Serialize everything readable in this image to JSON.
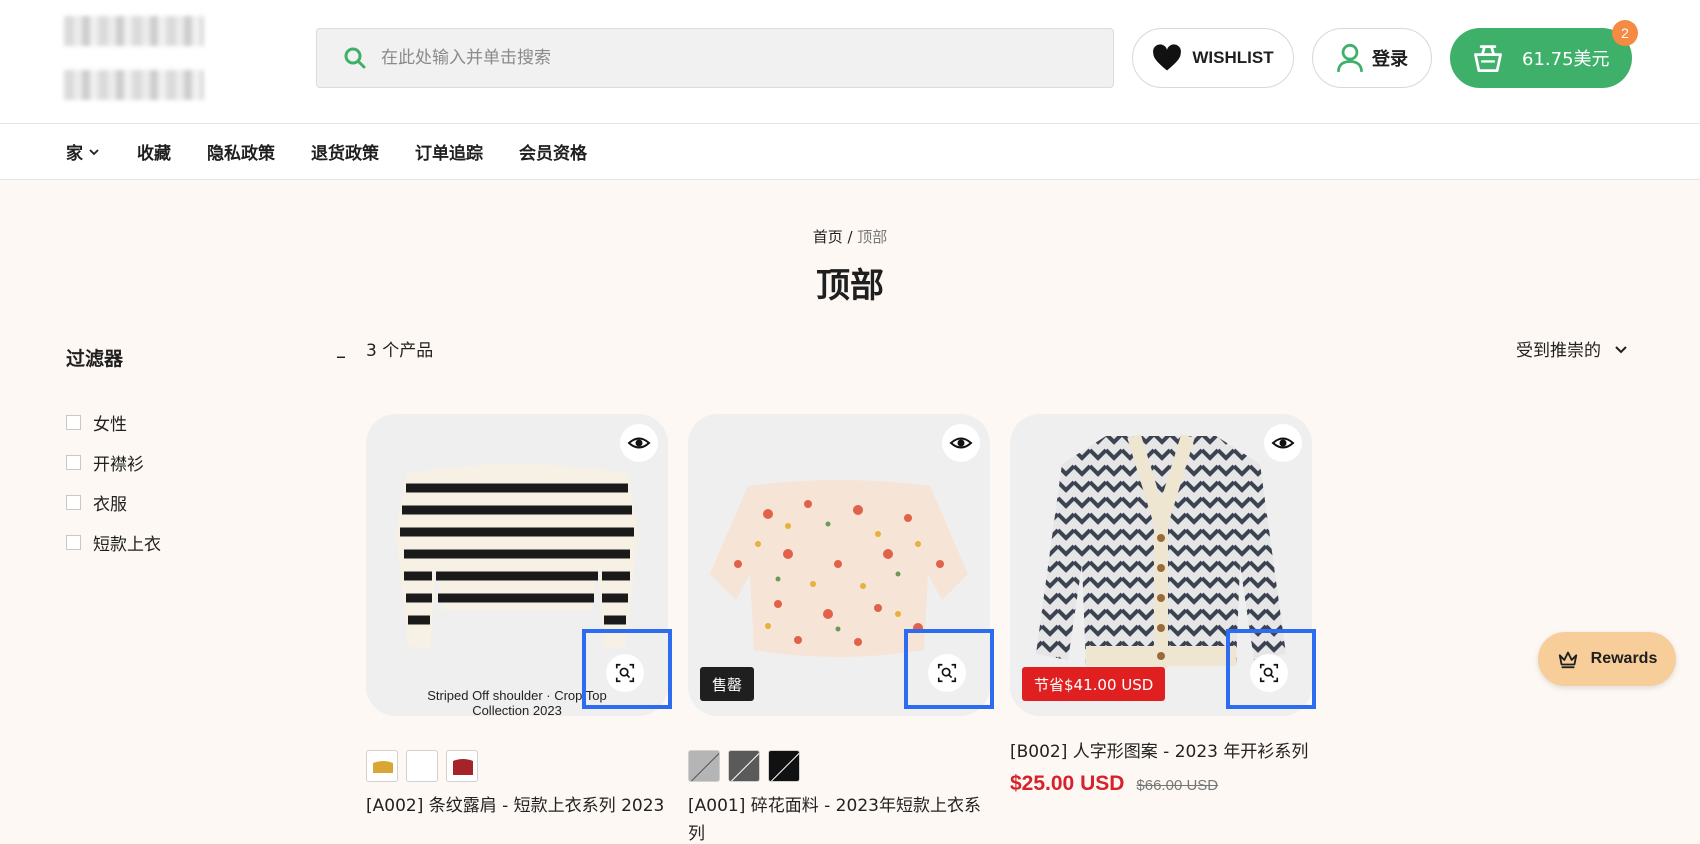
{
  "header": {
    "search_placeholder": "在此处输入并单击搜索",
    "wishlist_label": "WISHLIST",
    "login_label": "登录",
    "cart_total": "61.75美元",
    "cart_count": "2"
  },
  "nav": {
    "items": [
      "家",
      "收藏",
      "隐私政策",
      "退货政策",
      "订单追踪",
      "会员资格"
    ]
  },
  "breadcrumb": {
    "home": "首页",
    "separator": " / ",
    "current": "顶部"
  },
  "page_title": "顶部",
  "filters": {
    "heading": "过滤器",
    "collapse_symbol": "–",
    "options": [
      "女性",
      "开襟衫",
      "衣服",
      "短款上衣"
    ]
  },
  "toolbar": {
    "product_count": "3 个产品",
    "sort_label": "受到推崇的"
  },
  "products": [
    {
      "title": "[A002] 条纹露肩 - 短款上衣系列 2023",
      "image_caption_line1": "Striped Off shoulder · Crop Top",
      "image_caption_line2": "Collection 2023",
      "swatch_colors": [
        "#d9a534",
        "#ffffff",
        "#a6232a"
      ]
    },
    {
      "title": "[A001] 碎花面料 - 2023年短款上衣系列",
      "badge": "售罄",
      "swatch_colors": [
        "#b5b5b5",
        "#5a5a5a",
        "#111111"
      ]
    },
    {
      "title": "[B002] 人字形图案 - 2023 年开衫系列",
      "badge": "节省$41.00 USD",
      "price": "$25.00 USD",
      "compare_price": "$66.00 USD"
    }
  ],
  "rewards_label": "Rewards",
  "colors": {
    "accent_green": "#3eb069",
    "cart_badge": "#f58a42",
    "sale_red": "#d6222a",
    "highlight_blue": "#2d6cf0",
    "rewards_bg": "#f7cd9a"
  }
}
